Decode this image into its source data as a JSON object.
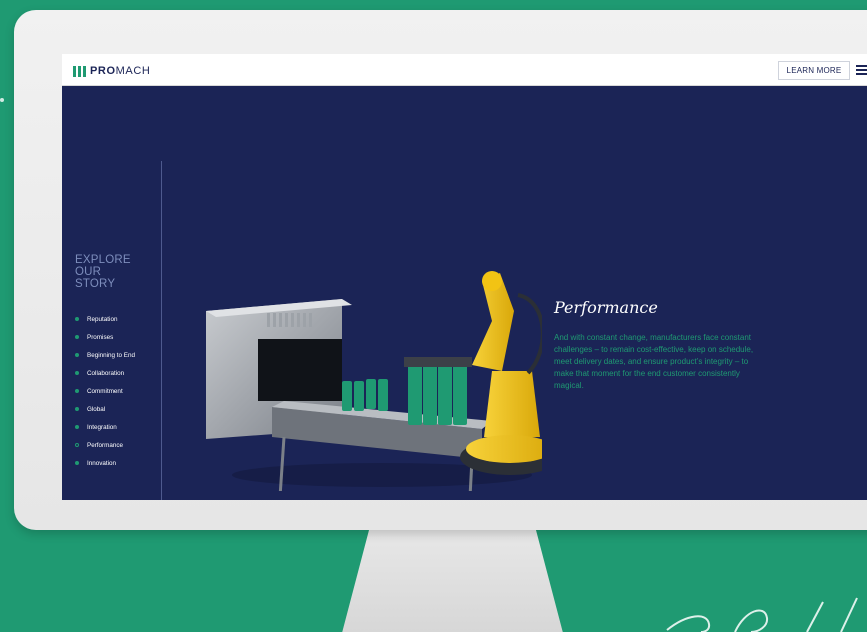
{
  "header": {
    "logo": {
      "bold": "PRO",
      "light": "MACH"
    },
    "learn_more_label": "LEARN MORE"
  },
  "sidebar": {
    "explore_lines": [
      "EXPLORE",
      "OUR",
      "STORY"
    ],
    "items": [
      {
        "label": "Reputation"
      },
      {
        "label": "Promises"
      },
      {
        "label": "Beginning to End"
      },
      {
        "label": "Collaboration"
      },
      {
        "label": "Commitment"
      },
      {
        "label": "Global"
      },
      {
        "label": "Integration"
      },
      {
        "label": "Performance",
        "active": true
      },
      {
        "label": "Innovation"
      }
    ]
  },
  "content": {
    "title": "Performance",
    "body": "And with constant change, manufacturers face constant challenges – to remain cost-effective, keep on schedule, meet delivery dates, and ensure product’s integrity – to make that moment for the end customer consistently magical."
  },
  "colors": {
    "background": "#1f9a72",
    "screen": "#1b2456",
    "accent": "#1f9a72",
    "robot": "#f2c314"
  },
  "icons": [
    "logo-bars-icon",
    "hamburger-menu-icon"
  ]
}
